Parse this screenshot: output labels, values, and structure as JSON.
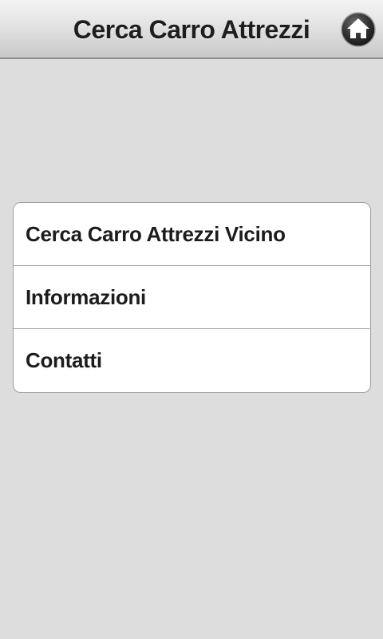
{
  "header": {
    "title": "Cerca Carro Attrezzi",
    "home_icon": "home-icon"
  },
  "menu": {
    "items": [
      {
        "label": "Cerca Carro Attrezzi Vicino"
      },
      {
        "label": "Informazioni"
      },
      {
        "label": "Contatti"
      }
    ]
  },
  "colors": {
    "background": "#dddddd",
    "list_background": "#ffffff",
    "text": "#1c1c1c"
  }
}
